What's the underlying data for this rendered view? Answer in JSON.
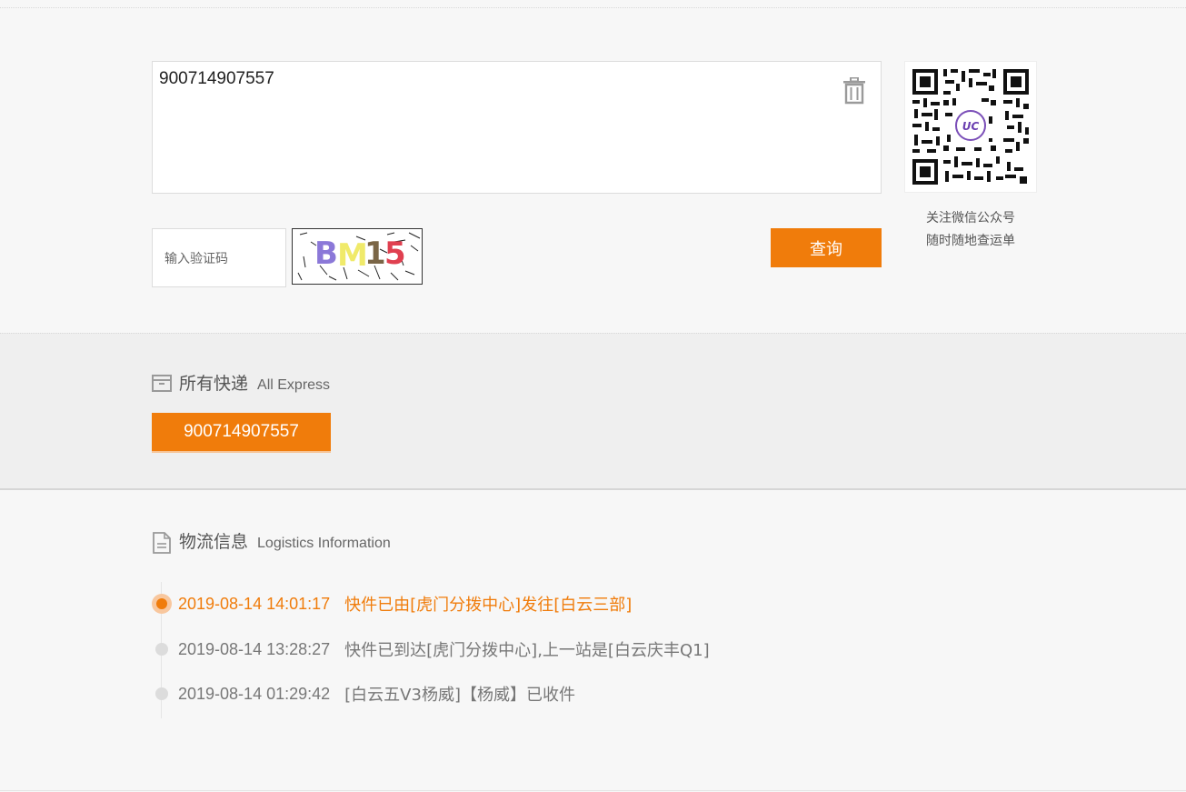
{
  "query": {
    "tracking_input_value": "900714907557",
    "captcha_placeholder": "输入验证码",
    "captcha_text": "BM15",
    "submit_label": "查询"
  },
  "qr": {
    "caption_line1": "关注微信公众号",
    "caption_line2": "随时随地查运单",
    "logo_text": "UC"
  },
  "express": {
    "title_cn": "所有快递",
    "title_en": "All Express",
    "tabs": [
      {
        "label": "900714907557",
        "active": true
      }
    ]
  },
  "logistics": {
    "title_cn": "物流信息",
    "title_en": "Logistics Information",
    "events": [
      {
        "time": "2019-08-14 14:01:17",
        "desc": "快件已由[虎门分拨中心]发往[白云三部]",
        "latest": true
      },
      {
        "time": "2019-08-14 13:28:27",
        "desc": "快件已到达[虎门分拨中心],上一站是[白云庆丰Q1]",
        "latest": false
      },
      {
        "time": "2019-08-14 01:29:42",
        "desc": "[白云五V3杨威]【杨威】已收件",
        "latest": false
      }
    ]
  },
  "colors": {
    "accent": "#f07c0b",
    "accent_light": "#f8c79e",
    "muted_dot": "#dcdcdc"
  },
  "icons": {
    "delete": "trash-icon",
    "express": "box-icon",
    "logistics": "document-icon"
  }
}
